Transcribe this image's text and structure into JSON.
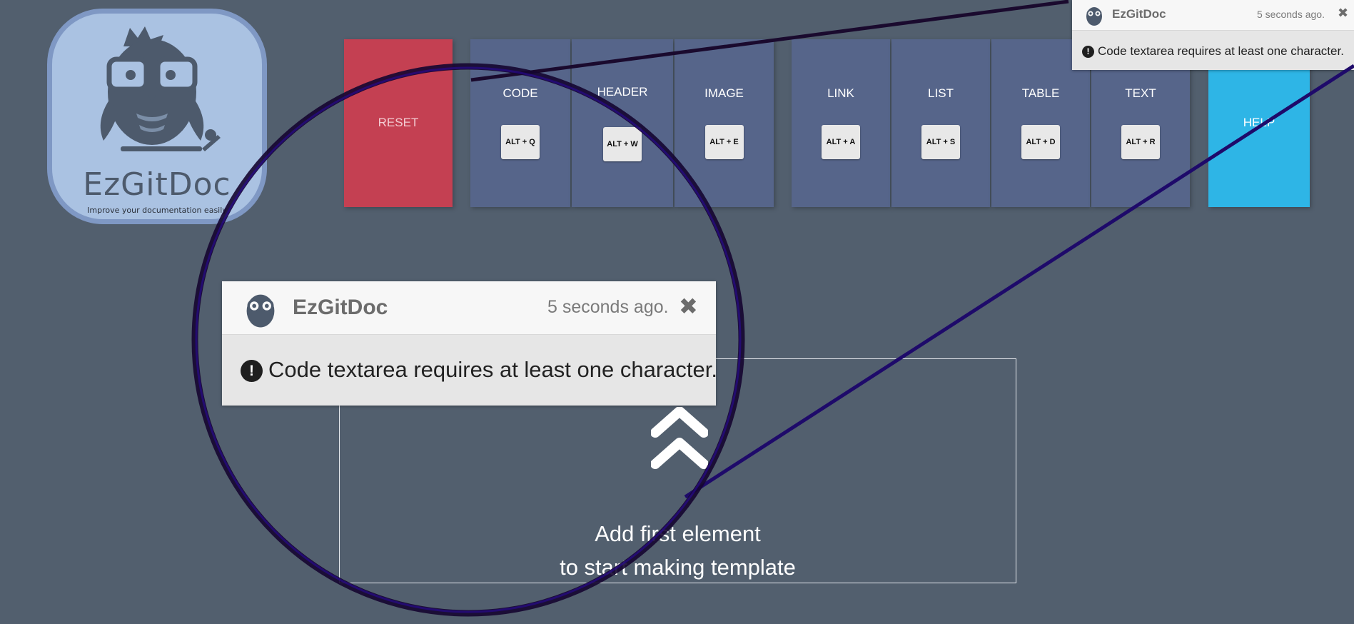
{
  "logo": {
    "title": "EzGitDoc",
    "tagline": "Improve your documentation easily"
  },
  "toolbar": {
    "reset_label": "RESET",
    "help_label": "HELP",
    "buttons": [
      {
        "label": "CODE",
        "shortcut": "ALT + Q"
      },
      {
        "label": "HEADER",
        "shortcut": "ALT + W"
      },
      {
        "label": "IMAGE",
        "shortcut": "ALT + E"
      },
      {
        "label": "LINK",
        "shortcut": "ALT + A"
      },
      {
        "label": "LIST",
        "shortcut": "ALT + S"
      },
      {
        "label": "TABLE",
        "shortcut": "ALT + D"
      },
      {
        "label": "TEXT",
        "shortcut": "ALT + R"
      }
    ]
  },
  "workspace": {
    "line1": "Add first element",
    "line2": "to start making template"
  },
  "notification": {
    "app": "EzGitDoc",
    "time": "5 seconds ago.",
    "close": "✖",
    "alert_glyph": "!",
    "message": "Code textarea requires at least one character."
  },
  "colors": {
    "background": "#525f6e",
    "reset": "#c44052",
    "tool_button": "#56658a",
    "help": "#2eb5e6",
    "logo_bg": "#aac2e2",
    "magnifier_ring": "#1a0a2e"
  }
}
